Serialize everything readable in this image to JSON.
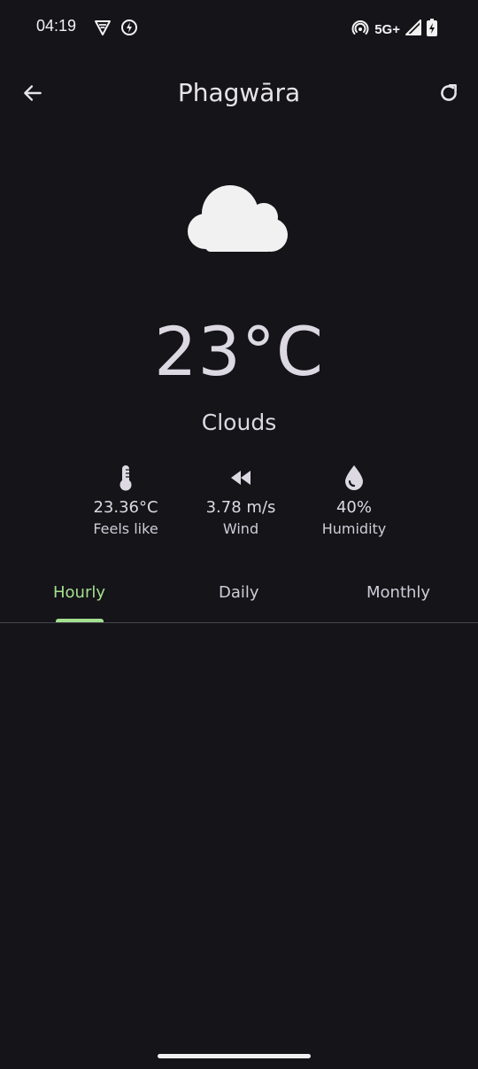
{
  "status_bar": {
    "time": "04:19",
    "network": "5G+",
    "left_icons": [
      "vpn-shield-icon",
      "data-saver-icon"
    ],
    "right_icons": [
      "hotspot-icon",
      "signal-icon",
      "battery-charging-icon"
    ]
  },
  "header": {
    "city": "Phagwāra",
    "back_icon": "arrow-left-icon",
    "refresh_icon": "refresh-icon"
  },
  "current": {
    "icon": "cloud-icon",
    "temperature": "23°C",
    "condition": "Clouds"
  },
  "stats": [
    {
      "icon": "thermometer-icon",
      "value": "23.36°C",
      "label": "Feels like"
    },
    {
      "icon": "wind-icon",
      "value": "3.78 m/s",
      "label": "Wind"
    },
    {
      "icon": "droplet-icon",
      "value": "40%",
      "label": "Humidity"
    }
  ],
  "tabs": [
    {
      "label": "Hourly",
      "active": true
    },
    {
      "label": "Daily",
      "active": false
    },
    {
      "label": "Monthly",
      "active": false
    }
  ],
  "colors": {
    "background": "#151419",
    "accent": "#a4e08f",
    "text": "#dcd9e3"
  }
}
